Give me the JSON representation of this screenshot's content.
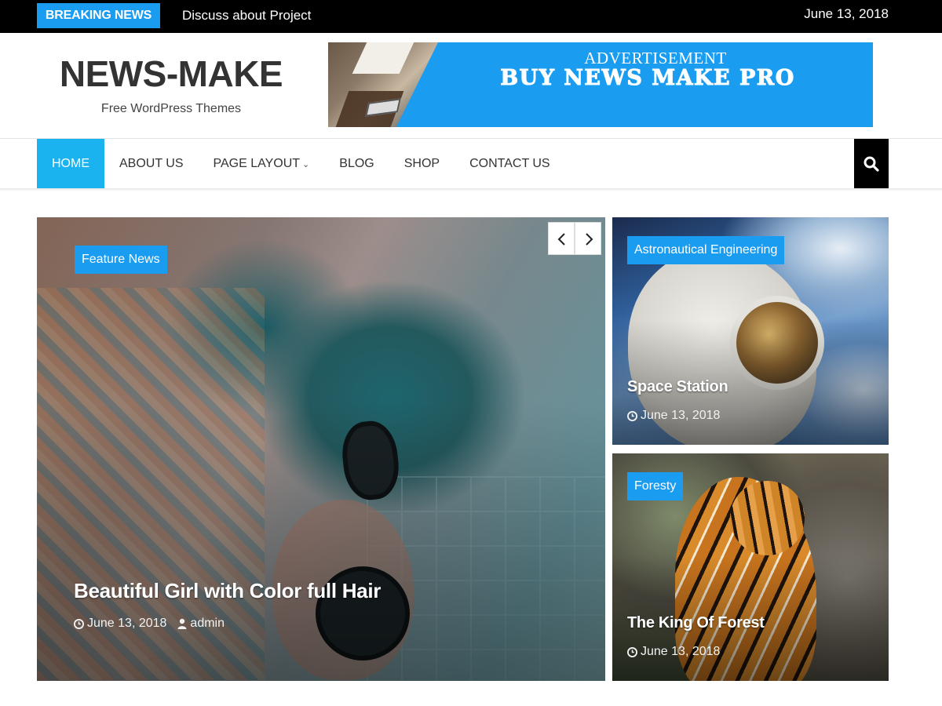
{
  "topbar": {
    "breaking_label": "BREAKING NEWS",
    "ticker_text": "Discuss about Project",
    "date": "June 13, 2018"
  },
  "header": {
    "site_title": "NEWS-MAKE",
    "tagline": "Free WordPress Themes"
  },
  "ad": {
    "label": "ADVERTISEMENT",
    "title": "BUY NEWS MAKE PRO"
  },
  "nav": {
    "items": [
      {
        "label": "HOME",
        "active": true
      },
      {
        "label": "ABOUT US"
      },
      {
        "label": "PAGE LAYOUT",
        "has_dropdown": true
      },
      {
        "label": "BLOG"
      },
      {
        "label": "SHOP"
      },
      {
        "label": "CONTACT US"
      }
    ],
    "search_icon": "search-icon"
  },
  "featured": {
    "main": {
      "category": "Feature News",
      "title": "Beautiful Girl with Color full Hair",
      "date": "June 13, 2018",
      "author": "admin"
    },
    "side": [
      {
        "category": "Astronautical Engineering",
        "title": "Space Station",
        "date": "June 13, 2018"
      },
      {
        "category": "Foresty",
        "title": "The King Of Forest",
        "date": "June 13, 2018"
      }
    ]
  },
  "colors": {
    "accent": "#1a9cf0",
    "nav_active": "#1ab2ef",
    "topbar_bg": "#000000"
  }
}
